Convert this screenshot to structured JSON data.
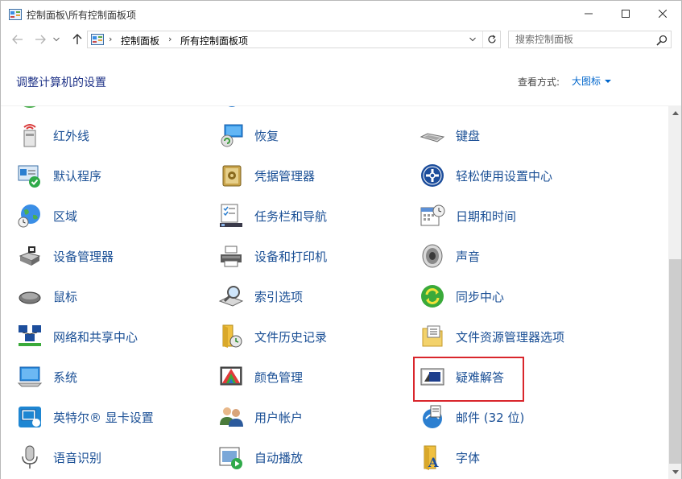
{
  "window": {
    "title": "控制面板\\所有控制面板项"
  },
  "nav": {
    "breadcrumbs": [
      "控制面板",
      "所有控制面板项"
    ],
    "search_placeholder": "搜索控制面板"
  },
  "header": {
    "page_title": "调整计算机的设置",
    "view_label": "查看方式:",
    "view_value": "大图标"
  },
  "items": {
    "infrared": "红外线",
    "recovery": "恢复",
    "keyboard": "键盘",
    "default_programs": "默认程序",
    "credential_manager": "凭据管理器",
    "ease_of_access": "轻松使用设置中心",
    "region": "区域",
    "taskbar_navigation": "任务栏和导航",
    "date_time": "日期和时间",
    "device_manager": "设备管理器",
    "devices_printers": "设备和打印机",
    "sound": "声音",
    "mouse": "鼠标",
    "indexing_options": "索引选项",
    "sync_center": "同步中心",
    "network_sharing": "网络和共享中心",
    "file_history": "文件历史记录",
    "file_explorer_options": "文件资源管理器选项",
    "system": "系统",
    "color_management": "颜色管理",
    "troubleshooting": "疑难解答",
    "intel_graphics": "英特尔® 显卡设置",
    "user_accounts": "用户帐户",
    "mail": "邮件 (32 位)",
    "speech_recognition": "语音识别",
    "autoplay": "自动播放",
    "fonts": "字体"
  },
  "colors": {
    "link": "#1a4f95",
    "title": "#1e3287",
    "highlight": "#d9262c"
  }
}
